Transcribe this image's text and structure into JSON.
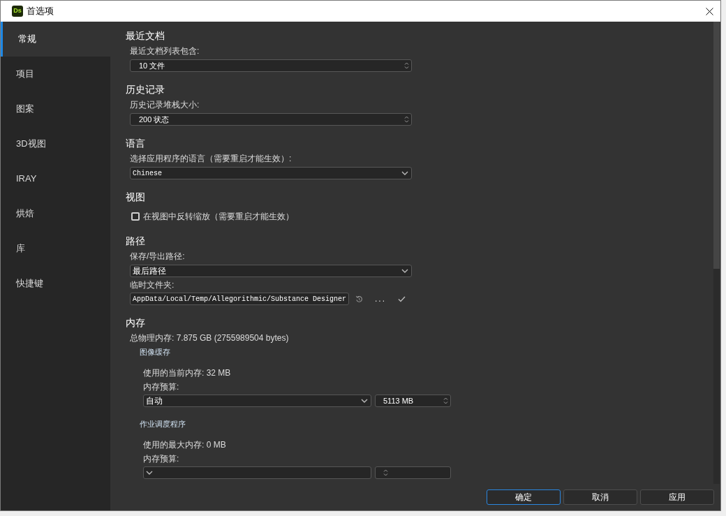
{
  "window": {
    "title": "首选项",
    "app_badge": "Ds"
  },
  "sidebar": {
    "items": [
      {
        "label": "常规",
        "selected": true
      },
      {
        "label": "项目",
        "selected": false
      },
      {
        "label": "图案",
        "selected": false
      },
      {
        "label": "3D视图",
        "selected": false
      },
      {
        "label": "IRAY",
        "selected": false
      },
      {
        "label": "烘焙",
        "selected": false
      },
      {
        "label": "库",
        "selected": false
      },
      {
        "label": "快捷键",
        "selected": false
      }
    ]
  },
  "sections": [
    {
      "heading": "最近文档",
      "rows": [
        {
          "kind": "label",
          "text": "最近文档列表包含:"
        },
        {
          "kind": "spinbox",
          "value": "10 文件"
        }
      ]
    },
    {
      "heading": "历史记录",
      "rows": [
        {
          "kind": "label",
          "text": "历史记录堆栈大小:"
        },
        {
          "kind": "spinbox",
          "value": "200 状态"
        }
      ]
    },
    {
      "heading": "语言",
      "rows": [
        {
          "kind": "label",
          "text": "选择应用程序的语言（需要重启才能生效）:"
        },
        {
          "kind": "dropdown",
          "value": "Chinese",
          "mono": true
        }
      ]
    },
    {
      "heading": "视图",
      "rows": [
        {
          "kind": "checkbox",
          "label": "在视图中反转缩放（需要重启才能生效）",
          "checked": false
        }
      ]
    },
    {
      "heading": "路径",
      "rows": [
        {
          "kind": "label",
          "text": "保存/导出路径:"
        },
        {
          "kind": "dropdown",
          "value": "最后路径",
          "mono": false
        },
        {
          "kind": "label",
          "text": "临时文件夹:"
        },
        {
          "kind": "path",
          "value": "AppData/Local/Temp/Allegorithmic/Substance Designer",
          "more": "..."
        }
      ]
    },
    {
      "heading": "内存",
      "rows": [
        {
          "kind": "label",
          "text": "总物理内存: 7.875 GB (2755989504 bytes)"
        },
        {
          "kind": "group",
          "title": "图像缓存",
          "rows": [
            {
              "kind": "label",
              "text": "使用的当前内存: 32 MB"
            },
            {
              "kind": "label",
              "text": "内存预算:"
            },
            {
              "kind": "budget",
              "mode": "自动",
              "amount": "5113 MB"
            }
          ]
        },
        {
          "kind": "group",
          "title": "作业调度程序",
          "rows": [
            {
              "kind": "label",
              "text": "使用的最大内存: 0 MB"
            },
            {
              "kind": "label",
              "text": "内存预算:"
            },
            {
              "kind": "budget"
            }
          ]
        }
      ]
    }
  ],
  "buttons": [
    {
      "label": "确定",
      "default": true
    },
    {
      "label": "取消",
      "default": false
    },
    {
      "label": "应用",
      "default": false
    }
  ]
}
